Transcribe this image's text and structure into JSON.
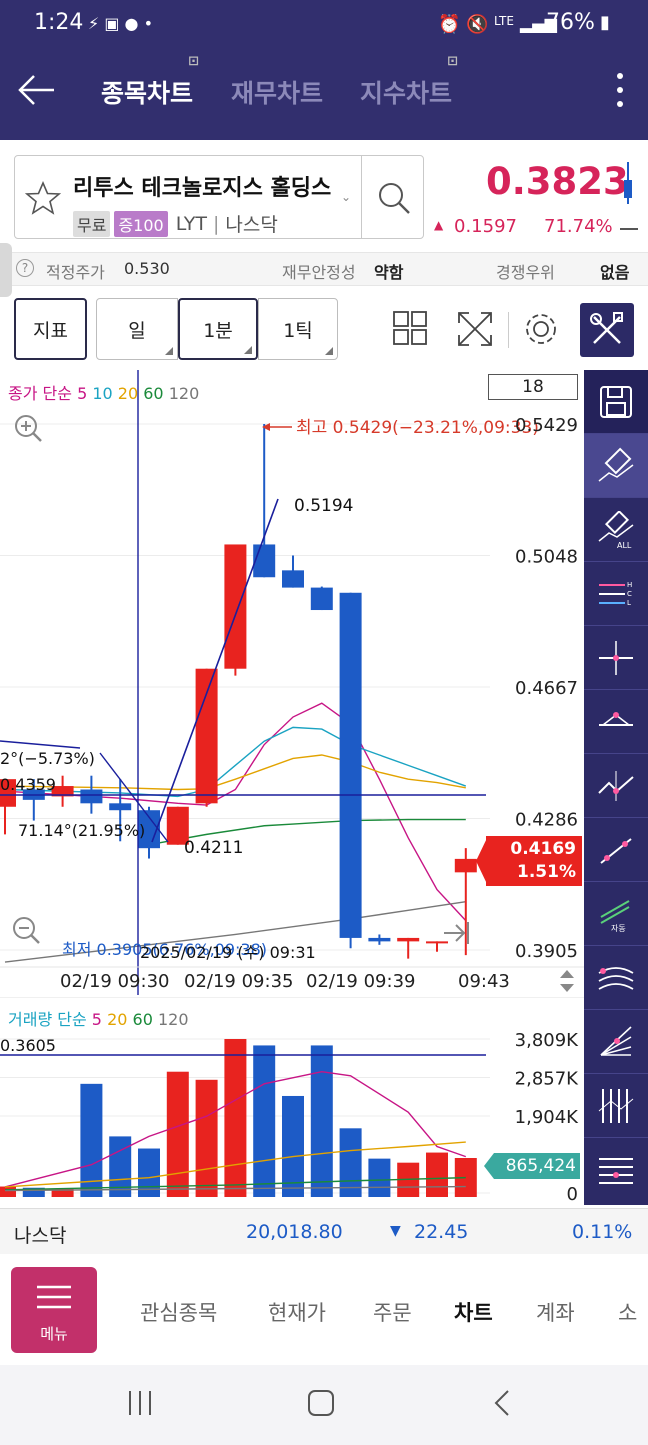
{
  "status": {
    "time": "1:24",
    "battery": "76%",
    "network": "LTE"
  },
  "header": {
    "tabs": [
      {
        "label": "종목차트",
        "active": true
      },
      {
        "label": "재무차트",
        "active": false
      },
      {
        "label": "지수차트",
        "active": false
      }
    ]
  },
  "stock": {
    "name": "리투스 테크놀로지스 홀딩스",
    "badges": [
      "무료",
      "증100"
    ],
    "ticker": "LYT",
    "exchange": "나스닥",
    "price": "0.3823",
    "change": "0.1597",
    "change_pct": "71.74%"
  },
  "info": {
    "fair_price_label": "적정주가",
    "fair_price_value": "0.530",
    "stability_label": "재무안정성",
    "stability_value": "약함",
    "competitive_label": "경쟁우위",
    "competitive_value": "없음"
  },
  "toolbar": {
    "indicator_label": "지표",
    "periods": [
      {
        "label": "일",
        "selected": false
      },
      {
        "label": "1분",
        "selected": true
      },
      {
        "label": "1틱",
        "selected": false
      }
    ]
  },
  "price_chart": {
    "legend_prefix": "종가 단순",
    "legend_periods": [
      "5",
      "10",
      "20",
      "60",
      "120"
    ],
    "legend_colors": [
      "#c71585",
      "#1aa3c2",
      "#e2a300",
      "#1a8a3a",
      "#777777"
    ],
    "count_box": "18",
    "high_label": "최고 0.5429(−23.21%,09:33)",
    "low_label": "최저 0.3905(6.76%,09:38)",
    "trend_label_1": "2°(−5.73%)",
    "trend_label_2": "71.14°(21.95%)",
    "level_label_1": "0.4359",
    "point_label_high": "0.5194",
    "point_label_low": "0.4211",
    "crosshair_time": "2025/02/19 (수) 09:31",
    "current_price": "0.4169",
    "current_pct": "1.51%",
    "y_ticks": [
      "0.5429",
      "0.5048",
      "0.4667",
      "0.4286",
      "0.3905"
    ],
    "x_ticks": [
      "02/19 09:30",
      "02/19 09:35",
      "02/19 09:39",
      "09:43"
    ]
  },
  "volume_chart": {
    "legend_prefix": "거래량 단순",
    "legend_periods": [
      "5",
      "20",
      "60",
      "120"
    ],
    "level_label": "0.3605",
    "y_ticks": [
      "3,809K",
      "2,857K",
      "1,904K",
      "0"
    ],
    "current_volume": "865,424"
  },
  "chart_data": [
    {
      "type": "candlestick",
      "title": "",
      "x": [
        "09:27",
        "09:28",
        "09:29",
        "09:30",
        "09:31",
        "09:32",
        "09:33",
        "09:34",
        "09:35",
        "09:36",
        "09:37",
        "09:38",
        "09:39",
        "09:40",
        "09:41",
        "09:42",
        "09:43"
      ],
      "series": [
        {
          "name": "candles",
          "values": [
            {
              "o": 0.432,
              "h": 0.44,
              "l": 0.424,
              "c": 0.44,
              "up": true
            },
            {
              "o": 0.434,
              "h": 0.44,
              "l": 0.428,
              "c": 0.437,
              "up": false
            },
            {
              "o": 0.438,
              "h": 0.441,
              "l": 0.432,
              "c": 0.435,
              "up": true
            },
            {
              "o": 0.437,
              "h": 0.441,
              "l": 0.43,
              "c": 0.433,
              "up": false
            },
            {
              "o": 0.433,
              "h": 0.44,
              "l": 0.422,
              "c": 0.431,
              "up": false
            },
            {
              "o": 0.431,
              "h": 0.432,
              "l": 0.417,
              "c": 0.42,
              "up": false
            },
            {
              "o": 0.421,
              "h": 0.432,
              "l": 0.421,
              "c": 0.432,
              "up": true
            },
            {
              "o": 0.433,
              "h": 0.472,
              "l": 0.432,
              "c": 0.472,
              "up": true
            },
            {
              "o": 0.472,
              "h": 0.508,
              "l": 0.47,
              "c": 0.508,
              "up": true
            },
            {
              "o": 0.508,
              "h": 0.5429,
              "l": 0.4985,
              "c": 0.4985,
              "up": false
            },
            {
              "o": 0.5005,
              "h": 0.5048,
              "l": 0.4955,
              "c": 0.4955,
              "up": false
            },
            {
              "o": 0.4955,
              "h": 0.4958,
              "l": 0.489,
              "c": 0.489,
              "up": false
            },
            {
              "o": 0.494,
              "h": 0.494,
              "l": 0.391,
              "c": 0.394,
              "up": false
            },
            {
              "o": 0.394,
              "h": 0.395,
              "l": 0.392,
              "c": 0.393,
              "up": false
            },
            {
              "o": 0.393,
              "h": 0.394,
              "l": 0.388,
              "c": 0.394,
              "up": true
            },
            {
              "o": 0.393,
              "h": 0.393,
              "l": 0.39,
              "c": 0.393,
              "up": true
            },
            {
              "o": 0.413,
              "h": 0.42,
              "l": 0.389,
              "c": 0.4169,
              "up": true
            }
          ]
        }
      ],
      "ylim": [
        0.3905,
        0.5429
      ]
    },
    {
      "type": "bar",
      "title": "",
      "categories": [
        "09:27",
        "09:28",
        "09:29",
        "09:30",
        "09:31",
        "09:32",
        "09:33",
        "09:34",
        "09:35",
        "09:36",
        "09:37",
        "09:38",
        "09:39",
        "09:40",
        "09:41",
        "09:42",
        "09:43"
      ],
      "series": [
        {
          "name": "volume",
          "values": [
            160000,
            130000,
            100000,
            2700000,
            1400000,
            1100000,
            3000000,
            2800000,
            3809000,
            3650000,
            2400000,
            3650000,
            1600000,
            850000,
            750000,
            1000000,
            865424
          ]
        }
      ],
      "ylim": [
        0,
        3809000
      ]
    }
  ]
}
